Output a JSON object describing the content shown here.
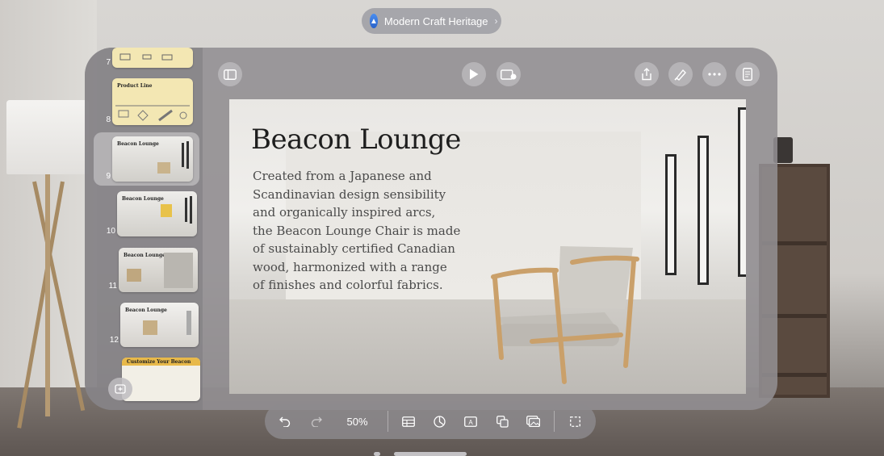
{
  "document": {
    "title": "Modern Craft Heritage"
  },
  "sidebar": {
    "slides": [
      {
        "number": "7",
        "title": ""
      },
      {
        "number": "8",
        "title": "Product Line"
      },
      {
        "number": "9",
        "title": "Beacon Lounge",
        "selected": true
      },
      {
        "number": "10",
        "title": "Beacon Lounge"
      },
      {
        "number": "11",
        "title": "Beacon Lounge"
      },
      {
        "number": "12",
        "title": "Beacon Lounge"
      },
      {
        "number": "",
        "title": "Customize Your Beacon"
      }
    ]
  },
  "slide": {
    "title": "Beacon Lounge",
    "body_lines": [
      "Created from a Japanese and",
      "Scandinavian design sensibility",
      "and organically inspired arcs,",
      "the Beacon Lounge Chair is made",
      "of sustainably certified Canadian",
      "wood, harmonized with a range",
      "of finishes and colorful fabrics."
    ]
  },
  "toolbar": {
    "zoom": "50%"
  },
  "colors": {
    "window": "#928e92",
    "accent": "#2a62c9",
    "slide_bg": "#efeeeb"
  },
  "icons": {
    "doc": "keynote-doc-icon",
    "sidebar_toggle": "sidebar-icon",
    "play": "play-icon",
    "live_video": "live-video-icon",
    "share": "share-icon",
    "format": "paintbrush-icon",
    "more": "ellipsis-icon",
    "document": "document-icon"
  }
}
